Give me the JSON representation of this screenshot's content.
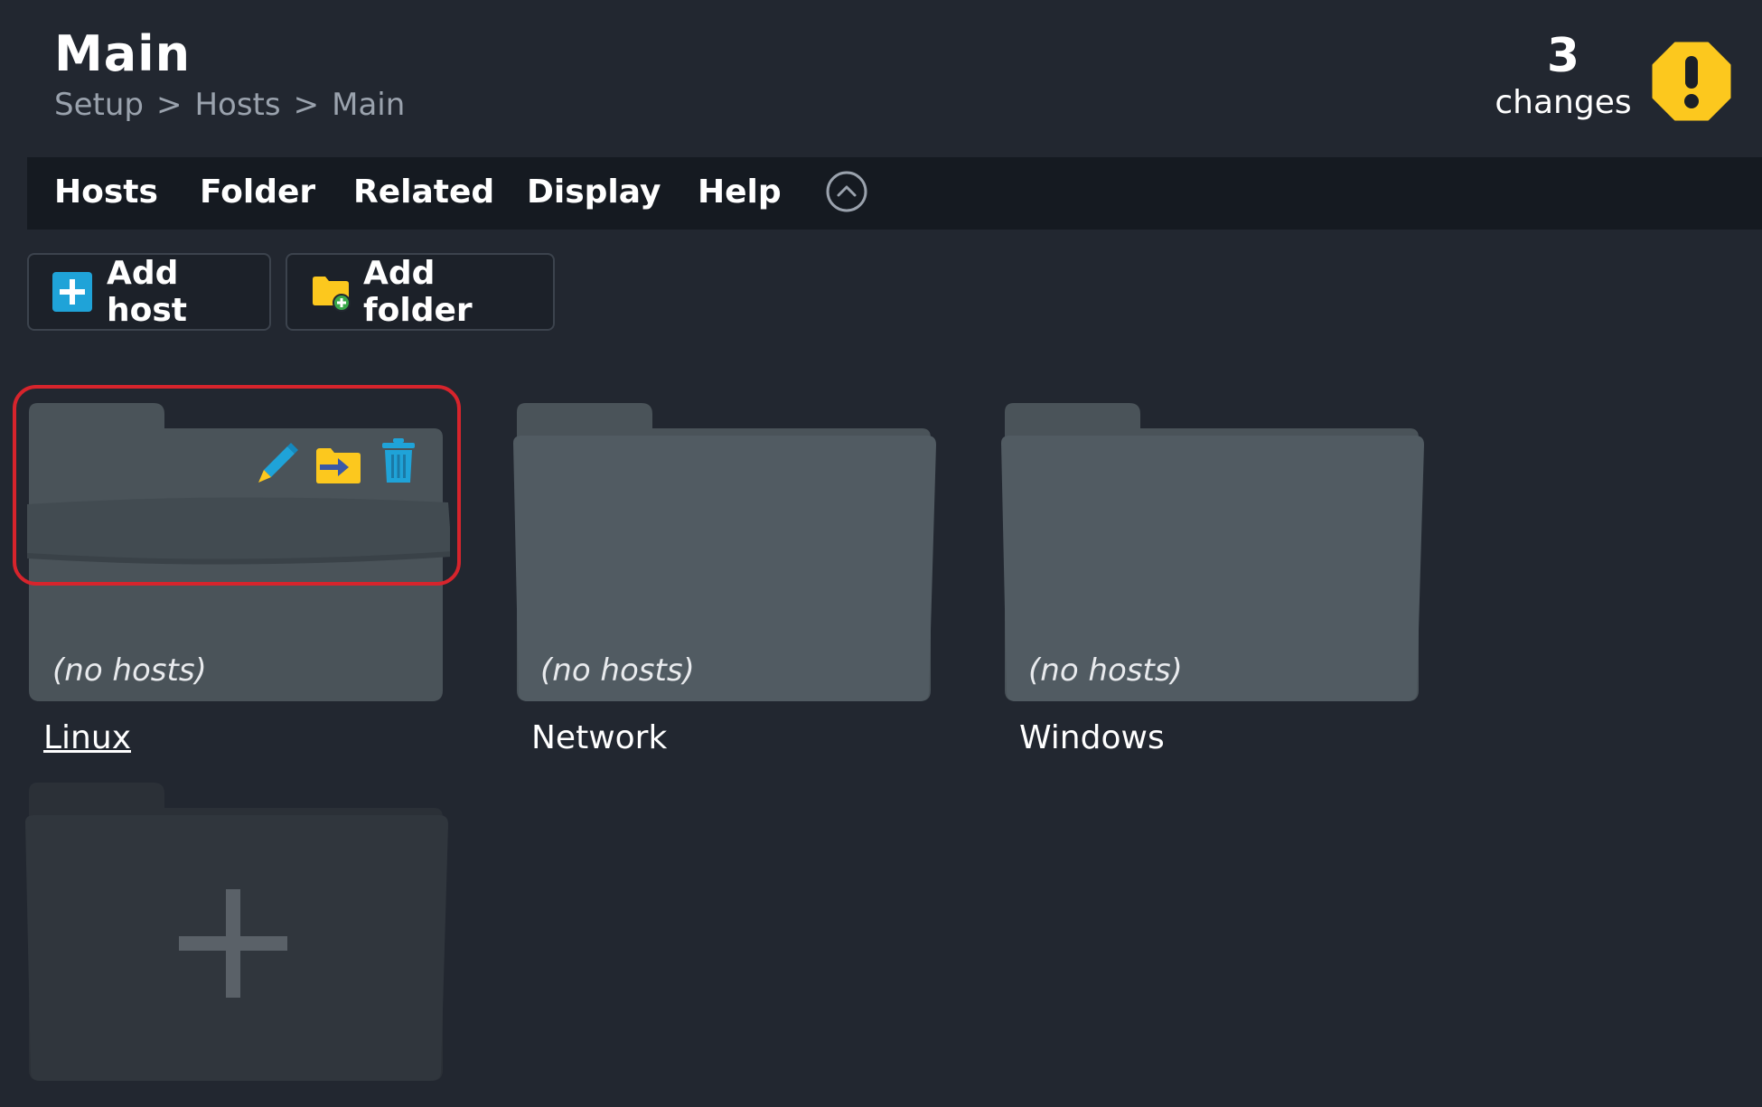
{
  "header": {
    "title": "Main",
    "breadcrumb": [
      "Setup",
      "Hosts",
      "Main"
    ],
    "breadcrumb_separator": ">",
    "changes_count": "3",
    "changes_label": "changes",
    "warning_icon": "exclamation-shield-icon"
  },
  "menu": {
    "items": [
      "Hosts",
      "Folder",
      "Related",
      "Display",
      "Help"
    ],
    "collapse_icon": "chevron-up-circle-icon"
  },
  "toolbar": {
    "add_host": "Add host",
    "add_folder": "Add folder"
  },
  "folders": [
    {
      "name": "Linux",
      "status": "(no hosts)",
      "hovered": true,
      "actions": [
        "edit-icon",
        "move-icon",
        "delete-icon"
      ]
    },
    {
      "name": "Network",
      "status": "(no hosts)"
    },
    {
      "name": "Windows",
      "status": "(no hosts)"
    }
  ],
  "new_folder_tile": {
    "icon": "plus-icon"
  },
  "colors": {
    "background": "#222730",
    "menubar": "#151a21",
    "folder": "#515b62",
    "accent_blue": "#1fa3d8",
    "warning_yellow": "#fcc81e",
    "highlight_red": "#d7242c"
  }
}
